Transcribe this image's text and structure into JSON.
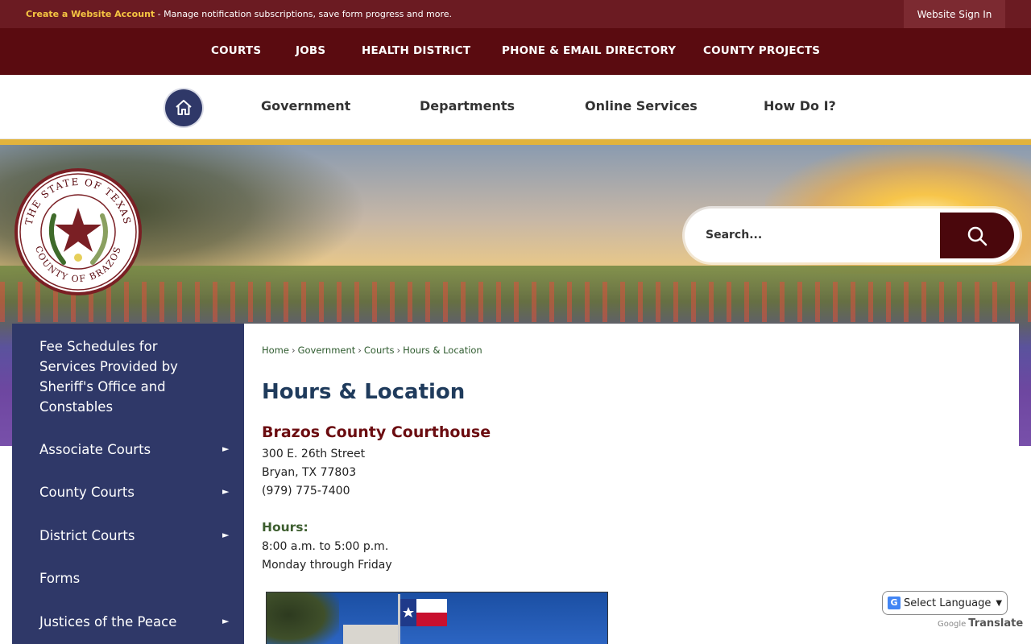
{
  "topbar": {
    "account_link": "Create a Website Account",
    "account_text": " - Manage notification subscriptions, save form progress and more.",
    "signin": "Website Sign In"
  },
  "secondary_nav": [
    "COURTS",
    "JOBS",
    "HEALTH DISTRICT",
    "PHONE & EMAIL DIRECTORY",
    "COUNTY PROJECTS"
  ],
  "main_nav": [
    "Government",
    "Departments",
    "Online Services",
    "How Do I?"
  ],
  "seal": {
    "top_text": "THE STATE OF TEXAS",
    "bottom_text": "COUNTY OF BRAZOS"
  },
  "search": {
    "placeholder": "Search..."
  },
  "sidebar": {
    "items": [
      {
        "label": "Fee Schedules for Services Provided by Sheriff's Office and Constables",
        "has_arrow": false
      },
      {
        "label": "Associate Courts",
        "has_arrow": true
      },
      {
        "label": "County Courts",
        "has_arrow": true
      },
      {
        "label": "District Courts",
        "has_arrow": true
      },
      {
        "label": "Forms",
        "has_arrow": false
      },
      {
        "label": "Justices of the Peace",
        "has_arrow": true
      }
    ],
    "arrow_glyph": "►"
  },
  "breadcrumb": [
    "Home",
    "Government",
    "Courts",
    "Hours & Location"
  ],
  "breadcrumb_sep": "›",
  "content": {
    "title": "Hours & Location",
    "building": "Brazos County Courthouse",
    "address1": "300 E. 26th Street",
    "address2": "Bryan, TX 77803",
    "phone": "(979) 775-7400",
    "hours_heading": "Hours:",
    "hours_time": "8:00 a.m. to 5:00 p.m.",
    "hours_days": "Monday through Friday"
  },
  "translate": {
    "select_label": "Select Language",
    "powered_by": "Google",
    "translate_word": "Translate"
  },
  "colors": {
    "topbar": "#6b1b22",
    "secnav": "#5a0b10",
    "sidebar": "#2f3868",
    "gold": "#e2b33c",
    "title": "#1f3b5c",
    "subtitle": "#6b0c10"
  }
}
